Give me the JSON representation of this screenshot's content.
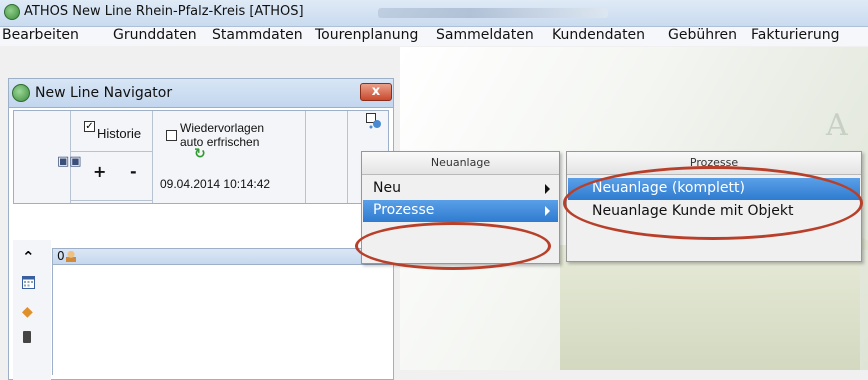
{
  "window": {
    "title": "ATHOS New Line Rhein-Pfalz-Kreis  [ATHOS]"
  },
  "menubar": {
    "items": [
      "Bearbeiten",
      "Grunddaten",
      "Stammdaten",
      "Tourenplanung",
      "Sammeldaten",
      "Kundendaten",
      "Gebühren",
      "Fakturierung"
    ]
  },
  "navigator": {
    "title": "New Line Navigator",
    "close_label": "x",
    "historie_label": "Historie",
    "historie_checked": true,
    "wiedervorlagen_label_1": "Wiedervorlagen",
    "wiedervorlagen_label_2": "auto erfrischen",
    "wiedervorlagen_checked": false,
    "plus_label": "+",
    "minus_label": "-",
    "timestamp": "09.04.2014 10:14:42",
    "list_count": "0"
  },
  "context_menu": {
    "header": "Neuanlage",
    "items": [
      {
        "label": "Neu",
        "submenu": true,
        "selected": false
      },
      {
        "label": "Prozesse",
        "submenu": true,
        "selected": true
      }
    ]
  },
  "submenu": {
    "header": "Prozesse",
    "items": [
      {
        "label": "Neuanlage (komplett)",
        "selected": true
      },
      {
        "label": "Neuanlage Kunde mit Objekt",
        "selected": false
      }
    ]
  },
  "colors": {
    "highlight": "#2f7bd0",
    "annotation": "#b8402a",
    "close": "#c9492e"
  }
}
